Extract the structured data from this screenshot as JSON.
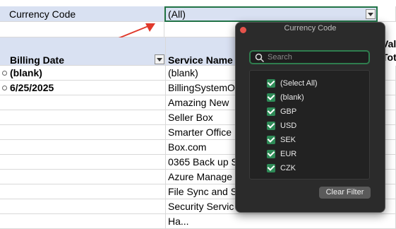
{
  "filter": {
    "label": "Currency Code",
    "value": "(All)"
  },
  "headers": {
    "billing_date": "Billing Date",
    "service_name": "Service Name",
    "edge_1": "Valu",
    "edge_2": "Tota"
  },
  "rows": [
    {
      "date": "(blank)",
      "service": "(blank)"
    },
    {
      "date": "6/25/2025",
      "service": "BillingSystemOne"
    },
    {
      "date": "",
      "service": "Amazing New"
    },
    {
      "date": "",
      "service": "Seller Box"
    },
    {
      "date": "",
      "service": "Smarter Office"
    },
    {
      "date": "",
      "service": "Box.com"
    },
    {
      "date": "",
      "service": "0365 Back up S"
    },
    {
      "date": "",
      "service": "Azure Manage"
    },
    {
      "date": "",
      "service": "File Sync and S"
    },
    {
      "date": "",
      "service": "Security Servic"
    },
    {
      "date": "",
      "service": "Ha..."
    }
  ],
  "popup": {
    "title": "Currency Code",
    "search_placeholder": "Search",
    "items": [
      "(Select All)",
      "(blank)",
      "GBP",
      "USD",
      "SEK",
      "EUR",
      "CZK"
    ],
    "clear_label": "Clear Filter"
  },
  "colors": {
    "header_fill": "#d9e1f2",
    "selected_border": "#217346",
    "arrow": "#e0392b",
    "checkbox": "#2e8b57"
  }
}
